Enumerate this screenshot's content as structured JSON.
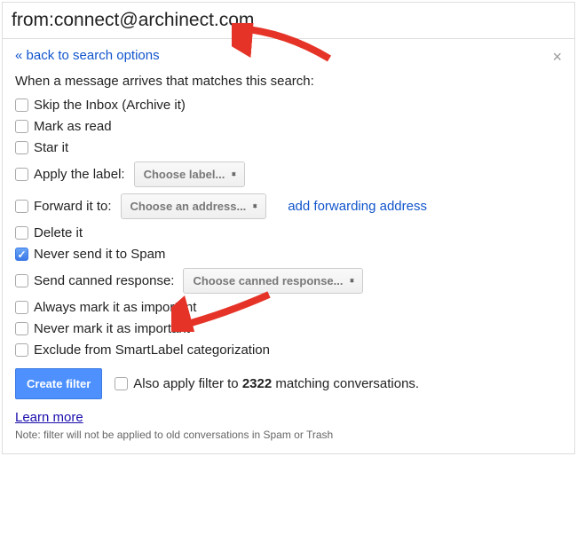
{
  "searchQuery": "from:connect@archinect.com",
  "backLink": "« back to search options",
  "intro": "When a message arrives that matches this search:",
  "options": {
    "skipInbox": "Skip the Inbox (Archive it)",
    "markRead": "Mark as read",
    "starIt": "Star it",
    "applyLabel": "Apply the label:",
    "chooseLabel": "Choose label...",
    "forwardTo": "Forward it to:",
    "chooseAddress": "Choose an address...",
    "addForwarding": "add forwarding address",
    "deleteIt": "Delete it",
    "neverSpam": "Never send it to Spam",
    "sendCanned": "Send canned response:",
    "chooseCanned": "Choose canned response...",
    "alwaysImportant": "Always mark it as important",
    "neverImportant": "Never mark it as important",
    "excludeSmartLabel": "Exclude from SmartLabel categorization"
  },
  "createFilterBtn": "Create filter",
  "alsoApplyPre": "Also apply filter to ",
  "alsoApplyCount": "2322",
  "alsoApplyPost": " matching conversations.",
  "learnMore": "Learn more",
  "note": "Note: filter will not be applied to old conversations in Spam or Trash"
}
